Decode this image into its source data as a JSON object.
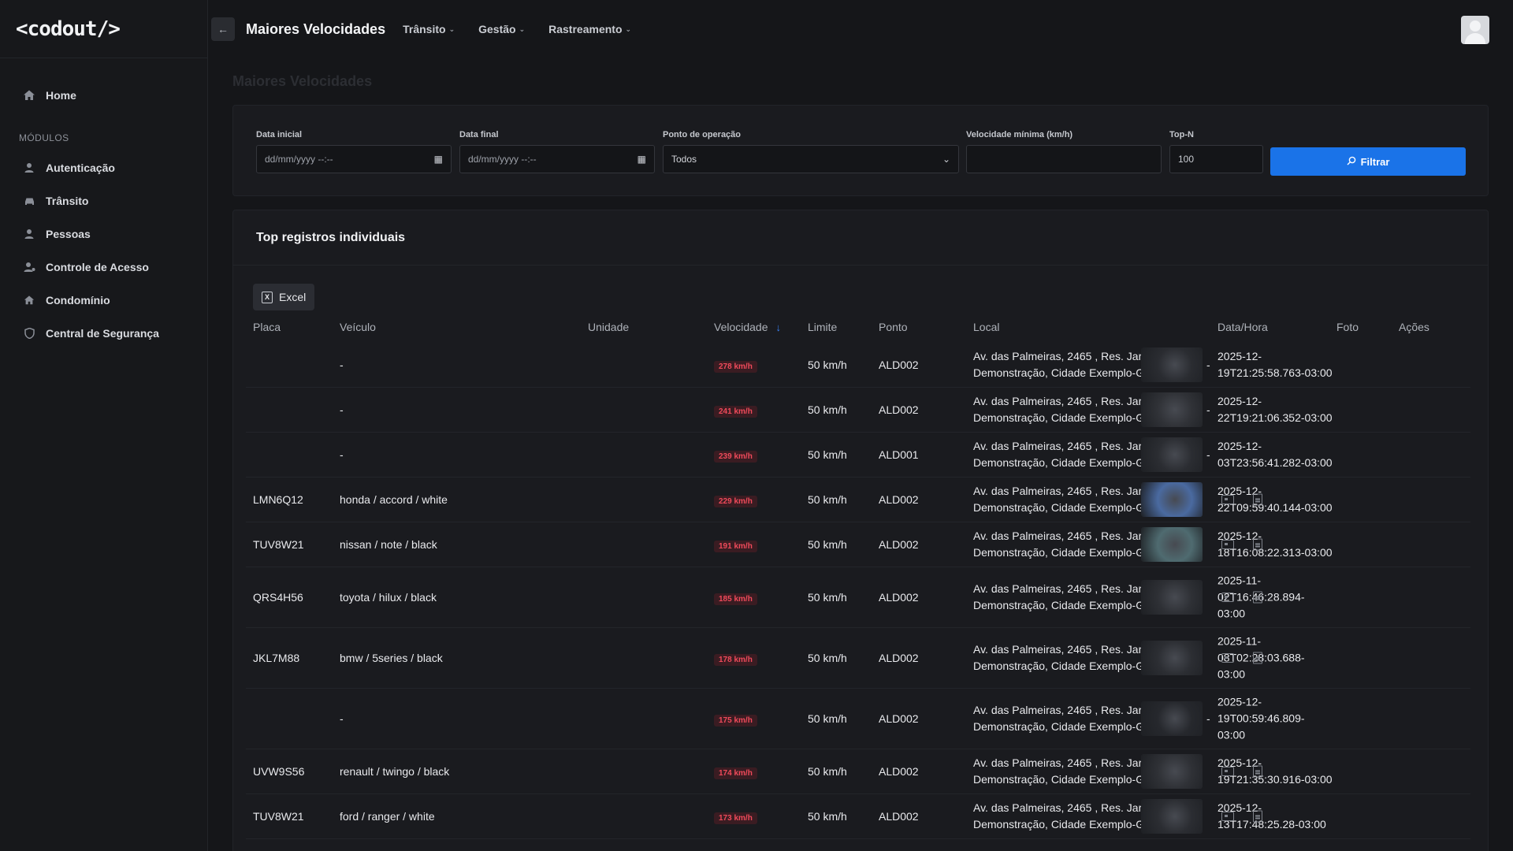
{
  "app": {
    "logo_text": "<codout/>",
    "page_title": "Maiores Velocidades",
    "collapse_icon": "arrow-left-icon",
    "top_menu": [
      {
        "label": "Trânsito"
      },
      {
        "label": "Gestão"
      },
      {
        "label": "Rastreamento"
      }
    ]
  },
  "sidebar": {
    "home_label": "Home",
    "section_label": "MÓDULOS",
    "items": [
      {
        "label": "Autenticação",
        "icon": "user-icon"
      },
      {
        "label": "Trânsito",
        "icon": "car-icon"
      },
      {
        "label": "Pessoas",
        "icon": "person-icon"
      },
      {
        "label": "Controle de Acesso",
        "icon": "user-check-icon"
      },
      {
        "label": "Condomínio",
        "icon": "home-icon"
      },
      {
        "label": "Central de Segurança",
        "icon": "shield-icon"
      }
    ]
  },
  "main": {
    "title": "Maiores Velocidades",
    "filters": {
      "start_label": "Data inicial",
      "start_value": "dd/mm/yyyy --:--",
      "end_label": "Data final",
      "end_value": "dd/mm/yyyy --:--",
      "point_label": "Ponto de operação",
      "point_value": "Todos",
      "minspeed_label": "Velocidade mínima (km/h)",
      "minspeed_value": "",
      "topn_label": "Top-N",
      "topn_value": "100",
      "filter_button": "Filtrar"
    },
    "card_title": "Top registros individuais",
    "excel_label": "Excel",
    "columns": {
      "plate": "Placa",
      "vehicle": "Veículo",
      "unit": "Unidade",
      "speed": "Velocidade",
      "limit": "Limite",
      "point": "Ponto",
      "local": "Local",
      "datetime": "Data/Hora",
      "photo": "Foto",
      "actions": "Ações"
    },
    "rows": [
      {
        "plate": "",
        "vehicle": "-",
        "speed": "278 km/h",
        "limit": "50 km/h",
        "point": "ALD002",
        "local1": "Av. das Palmeiras, 2465 , Res. Jardim",
        "local2": "Demonstração, Cidade Exemplo-GO",
        "dt": [
          "2025-12-",
          "19T21:25:58.763-03:00"
        ],
        "actions": "-"
      },
      {
        "plate": "",
        "vehicle": "-",
        "speed": "241 km/h",
        "limit": "50 km/h",
        "point": "ALD002",
        "local1": "Av. das Palmeiras, 2465 , Res. Jardim",
        "local2": "Demonstração, Cidade Exemplo-GO",
        "dt": [
          "2025-12-",
          "22T19:21:06.352-03:00"
        ],
        "actions": "-"
      },
      {
        "plate": "",
        "vehicle": "-",
        "speed": "239 km/h",
        "limit": "50 km/h",
        "point": "ALD001",
        "local1": "Av. das Palmeiras, 2465 , Res. Jardim",
        "local2": "Demonstração, Cidade Exemplo-GO",
        "dt": [
          "2025-12-",
          "03T23:56:41.282-03:00"
        ],
        "actions": "-"
      },
      {
        "plate": "LMN6Q12",
        "vehicle": "honda / accord / white",
        "speed": "229 km/h",
        "limit": "50 km/h",
        "point": "ALD002",
        "local1": "Av. das Palmeiras, 2465 , Res. Jardim",
        "local2": "Demonstração, Cidade Exemplo-GO",
        "dt": [
          "2025-12-",
          "22T09:59:40.144-03:00"
        ],
        "actions": ""
      },
      {
        "plate": "TUV8W21",
        "vehicle": "nissan / note / black",
        "speed": "191 km/h",
        "limit": "50 km/h",
        "point": "ALD002",
        "local1": "Av. das Palmeiras, 2465 , Res. Jardim",
        "local2": "Demonstração, Cidade Exemplo-GO",
        "dt": [
          "2025-12-",
          "18T16:08:22.313-03:00"
        ],
        "actions": ""
      },
      {
        "plate": "QRS4H56",
        "vehicle": "toyota / hilux / black",
        "speed": "185 km/h",
        "limit": "50 km/h",
        "point": "ALD002",
        "local1": "Av. das Palmeiras, 2465 , Res. Jardim",
        "local2": "Demonstração, Cidade Exemplo-GO",
        "dt": [
          "2025-11-",
          "02T16:46:28.894-",
          "03:00"
        ],
        "actions": ""
      },
      {
        "plate": "JKL7M88",
        "vehicle": "bmw / 5series / black",
        "speed": "178 km/h",
        "limit": "50 km/h",
        "point": "ALD002",
        "local1": "Av. das Palmeiras, 2465 , Res. Jardim",
        "local2": "Demonstração, Cidade Exemplo-GO",
        "dt": [
          "2025-11-",
          "08T02:28:03.688-",
          "03:00"
        ],
        "actions": ""
      },
      {
        "plate": "",
        "vehicle": "-",
        "speed": "175 km/h",
        "limit": "50 km/h",
        "point": "ALD002",
        "local1": "Av. das Palmeiras, 2465 , Res. Jardim",
        "local2": "Demonstração, Cidade Exemplo-GO",
        "dt": [
          "2025-12-",
          "19T00:59:46.809-",
          "03:00"
        ],
        "actions": "-"
      },
      {
        "plate": "UVW9S56",
        "vehicle": "renault / twingo / black",
        "speed": "174 km/h",
        "limit": "50 km/h",
        "point": "ALD002",
        "local1": "Av. das Palmeiras, 2465 , Res. Jardim",
        "local2": "Demonstração, Cidade Exemplo-GO",
        "dt": [
          "2025-12-",
          "19T21:35:30.916-03:00"
        ],
        "actions": ""
      },
      {
        "plate": "TUV8W21",
        "vehicle": "ford / ranger / white",
        "speed": "173 km/h",
        "limit": "50 km/h",
        "point": "ALD002",
        "local1": "Av. das Palmeiras, 2465 , Res. Jardim",
        "local2": "Demonstração, Cidade Exemplo-GO",
        "dt": [
          "2025-12-",
          "13T17:48:25.28-03:00"
        ],
        "actions": ""
      }
    ]
  }
}
